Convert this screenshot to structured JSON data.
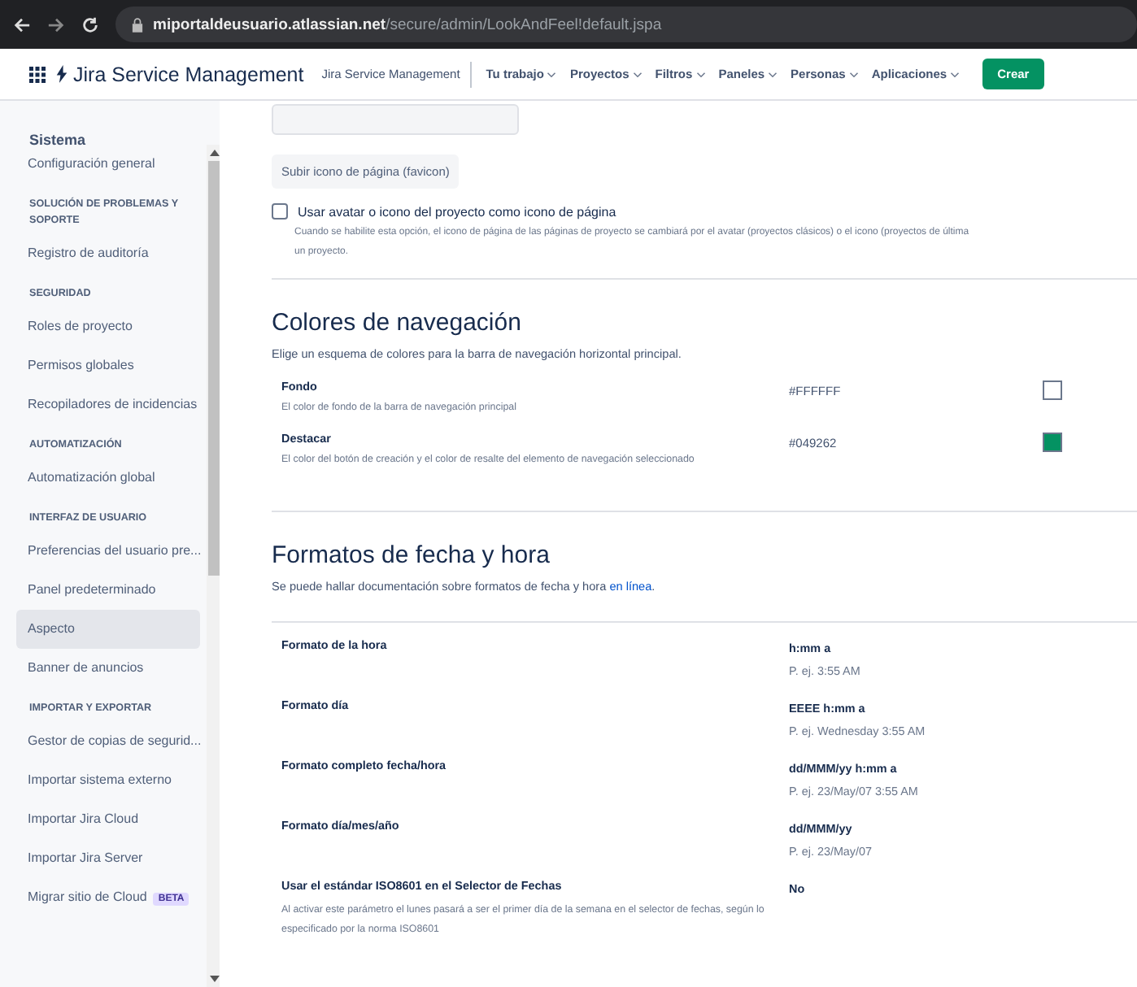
{
  "browser": {
    "url_domain": "miportaldeusuario.atlassian.net",
    "url_path": "/secure/admin/LookAndFeel!default.jspa"
  },
  "nav": {
    "product": "Jira Service Management",
    "project": "Jira Service Management",
    "menus": [
      "Tu trabajo",
      "Proyectos",
      "Filtros",
      "Paneles",
      "Personas",
      "Aplicaciones"
    ],
    "create": "Crear"
  },
  "sidebar": {
    "items": [
      {
        "kind": "title",
        "label": "Sistema"
      },
      {
        "kind": "item",
        "label": "Configuración general",
        "selected": false
      },
      {
        "kind": "section",
        "label": "SOLUCIÓN DE PROBLEMAS Y SOPORTE"
      },
      {
        "kind": "item",
        "label": "Registro de auditoría",
        "selected": false
      },
      {
        "kind": "section",
        "label": "SEGURIDAD"
      },
      {
        "kind": "item",
        "label": "Roles de proyecto",
        "selected": false
      },
      {
        "kind": "item",
        "label": "Permisos globales",
        "selected": false
      },
      {
        "kind": "item",
        "label": "Recopiladores de incidencias",
        "selected": false
      },
      {
        "kind": "section",
        "label": "AUTOMATIZACIÓN"
      },
      {
        "kind": "item",
        "label": "Automatización global",
        "selected": false
      },
      {
        "kind": "section",
        "label": "INTERFAZ DE USUARIO"
      },
      {
        "kind": "item",
        "label": "Preferencias del usuario pre...",
        "selected": false
      },
      {
        "kind": "item",
        "label": "Panel predeterminado",
        "selected": false
      },
      {
        "kind": "item",
        "label": "Aspecto",
        "selected": true
      },
      {
        "kind": "item",
        "label": "Banner de anuncios",
        "selected": false
      },
      {
        "kind": "section",
        "label": "IMPORTAR Y EXPORTAR"
      },
      {
        "kind": "item",
        "label": "Gestor de copias de segurid...",
        "selected": false
      },
      {
        "kind": "item",
        "label": "Importar sistema externo",
        "selected": false
      },
      {
        "kind": "item",
        "label": "Importar Jira Cloud",
        "selected": false
      },
      {
        "kind": "item",
        "label": "Importar Jira Server",
        "selected": false
      },
      {
        "kind": "item",
        "label": "Migrar sitio de Cloud",
        "badge": "BETA",
        "selected": false
      }
    ]
  },
  "favicon": {
    "upload_button": "Subir icono de página (favicon)",
    "checkbox": {
      "label": "Usar avatar o icono del proyecto como icono de página",
      "checked": false,
      "description_lines": [
        "Cuando se habilite esta opción, el icono de página de las páginas de proyecto se cambiará por el avatar (proyectos clásicos) o el icono (proyectos de última",
        "un proyecto."
      ]
    }
  },
  "nav_colors": {
    "title": "Colores de navegación",
    "subtitle": "Elige un esquema de colores para la barra de navegación horizontal principal.",
    "rows": [
      {
        "name": "Fondo",
        "description": "El color de fondo de la barra de navegación principal",
        "value": "#FFFFFF",
        "color": "#ffffff"
      },
      {
        "name": "Destacar",
        "description": "El color del botón de creación y el color de resalte del elemento de navegación seleccionado",
        "value": "#049262",
        "color": "#049262"
      }
    ]
  },
  "date_formats": {
    "title": "Formatos de fecha y hora",
    "subtitle": "Se puede hallar documentación sobre formatos de fecha y hora ",
    "link": "en línea",
    "subtitle_end": ".",
    "rows": [
      {
        "name": "Formato de la hora",
        "value": "h:mm a",
        "example": "P. ej. 3:55 AM"
      },
      {
        "name": "Formato día",
        "value": "EEEE h:mm a",
        "example": "P. ej. Wednesday 3:55 AM"
      },
      {
        "name": "Formato completo fecha/hora",
        "value": "dd/MMM/yy h:mm a",
        "example": "P. ej. 23/May/07 3:55 AM"
      },
      {
        "name": "Formato día/mes/año",
        "value": "dd/MMM/yy",
        "example": "P. ej. 23/May/07"
      },
      {
        "name": "Usar el estándar ISO8601 en el Selector de Fechas",
        "description": "Al activar este parámetro el lunes pasará a ser el primer día de la semana en el selector de fechas, según lo especificado por la norma ISO8601",
        "value": "No"
      }
    ]
  }
}
